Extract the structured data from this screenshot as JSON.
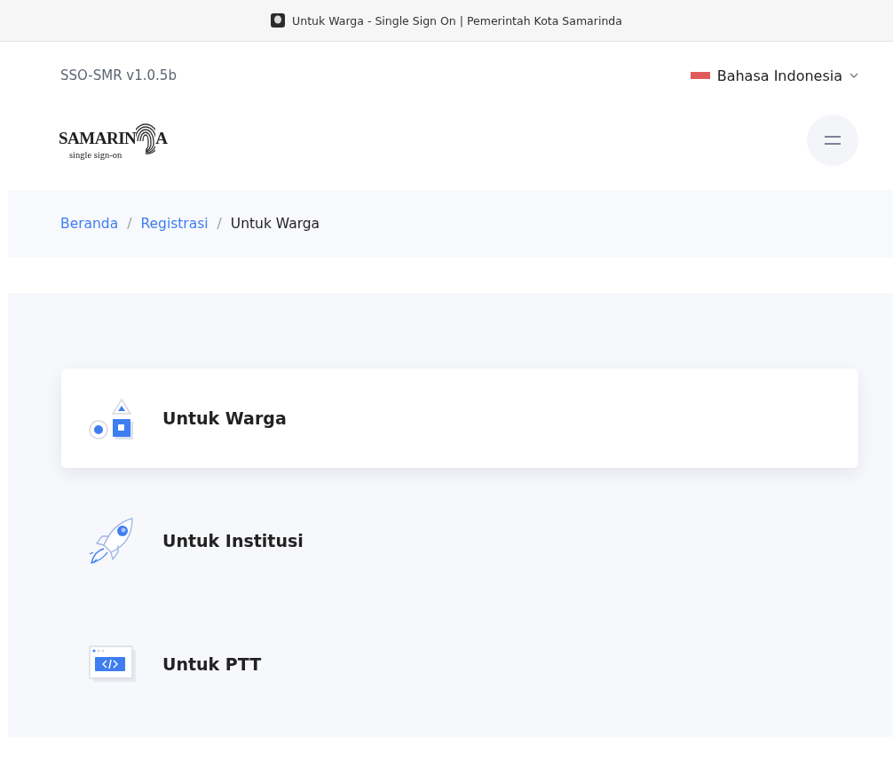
{
  "window": {
    "title": "Untuk Warga - Single Sign On | Pemerintah Kota Samarinda"
  },
  "header": {
    "version": "SSO-SMR v1.0.5b",
    "language": "Bahasa Indonesia",
    "logo": {
      "word_start": "SAMARIN",
      "word_end": "A",
      "tagline": "single sign-on"
    }
  },
  "breadcrumb": [
    {
      "kind": "link",
      "label": "Beranda"
    },
    {
      "kind": "separator",
      "label": "/"
    },
    {
      "kind": "link",
      "label": "Registrasi"
    },
    {
      "kind": "separator",
      "label": "/"
    },
    {
      "kind": "current",
      "label": "Untuk Warga"
    }
  ],
  "options": [
    {
      "kind": "shapes",
      "label": "Untuk Warga",
      "selected": true
    },
    {
      "kind": "rocket",
      "label": "Untuk Institusi",
      "selected": false
    },
    {
      "kind": "code",
      "label": "Untuk PTT",
      "selected": false
    }
  ]
}
